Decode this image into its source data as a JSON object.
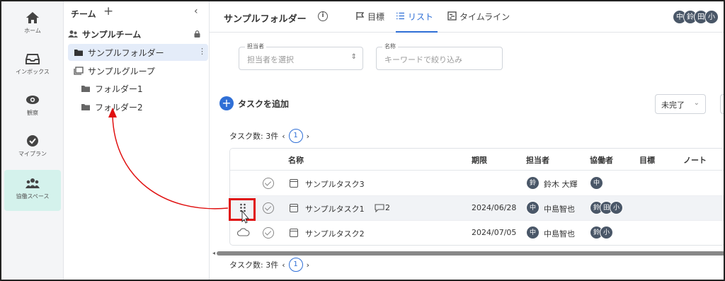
{
  "rail": {
    "items": [
      {
        "label": "ホーム",
        "icon": "home-icon"
      },
      {
        "label": "インボックス",
        "icon": "inbox-icon"
      },
      {
        "label": "観察",
        "icon": "eye-icon"
      },
      {
        "label": "マイプラン",
        "icon": "check-circle-icon"
      },
      {
        "label": "協働スペース",
        "icon": "people-icon",
        "active": true
      }
    ]
  },
  "panel": {
    "title": "チーム",
    "team": "サンプルチーム",
    "tree": [
      {
        "label": "サンプルフォルダー",
        "icon": "folder-icon",
        "selected": true
      },
      {
        "label": "サンプルグループ",
        "icon": "group-icon"
      },
      {
        "label": "フォルダー1",
        "icon": "folder-icon"
      },
      {
        "label": "フォルダー2",
        "icon": "folder-icon"
      }
    ]
  },
  "header": {
    "title": "サンプルフォルダー",
    "tabs": [
      {
        "label": "目標",
        "icon": "flag-icon"
      },
      {
        "label": "リスト",
        "icon": "list-icon",
        "active": true
      },
      {
        "label": "タイムライン",
        "icon": "timeline-icon"
      }
    ],
    "members": [
      "中",
      "鈴",
      "田",
      "小"
    ]
  },
  "filters": {
    "assignee_label": "担当者",
    "assignee_placeholder": "担当者を選択",
    "name_label": "名称",
    "name_placeholder": "キーワードで絞り込み"
  },
  "toolbar": {
    "add_task": "タスクを追加",
    "status": "未完了"
  },
  "pager": {
    "count_label": "タスク数: 3件",
    "page": "1"
  },
  "table": {
    "columns": [
      "名称",
      "期限",
      "担当者",
      "協働者",
      "目標",
      "ノート"
    ],
    "rows": [
      {
        "name": "サンプルタスク3",
        "due": "",
        "assignee_avatar": "鈴",
        "assignee": "鈴木 大輝",
        "collaborators": [
          "中"
        ],
        "comments": ""
      },
      {
        "name": "サンプルタスク1",
        "due": "2024/06/28",
        "assignee_avatar": "中",
        "assignee": "中島智也",
        "collaborators": [
          "鈴",
          "田",
          "小"
        ],
        "comments": "2"
      },
      {
        "name": "サンプルタスク2",
        "due": "2024/07/05",
        "assignee_avatar": "中",
        "assignee": "中島智也",
        "collaborators": [
          "鈴",
          "小"
        ],
        "comments": ""
      }
    ]
  },
  "colors": {
    "accent": "#2f6fd6",
    "active_rail": "#d4f2ec",
    "annotation": "#e01010"
  }
}
